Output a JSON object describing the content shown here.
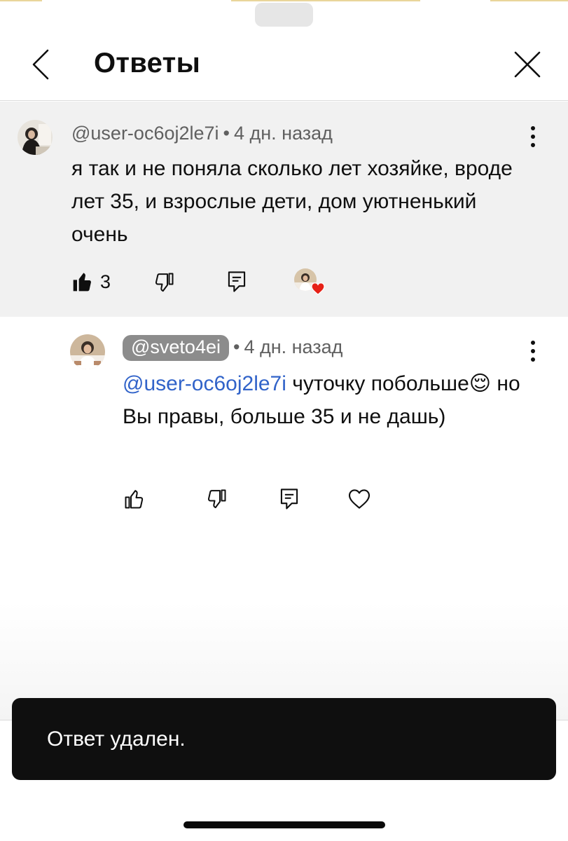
{
  "header": {
    "title": "Ответы",
    "back_icon": "chevron-left-icon",
    "close_icon": "close-icon"
  },
  "comment": {
    "author": "@user-oc6oj2le7i",
    "separator": "•",
    "time": "4 дн. назад",
    "text": "я так и не поняла сколько лет хозяйке, вроде лет 35, и взрослые дети, дом уютненький очень",
    "likes": "3",
    "liked": true,
    "creator_hearted": true
  },
  "reply": {
    "author": "@sveto4ei",
    "separator": "•",
    "time": "4 дн. назад",
    "mention": "@user-oc6oj2le7i",
    "text_part1": " чуточку побольше",
    "emoji": "😌",
    "text_part2": " но Вы правы, больше 35 и не дашь)"
  },
  "toast": {
    "message": "Ответ удален."
  },
  "colors": {
    "link": "#3163c9",
    "heart": "#e62117",
    "toast_bg": "#0f0f0f",
    "comment_bg": "#f1f1f1",
    "mention_chip_bg": "#8c8c8c"
  }
}
